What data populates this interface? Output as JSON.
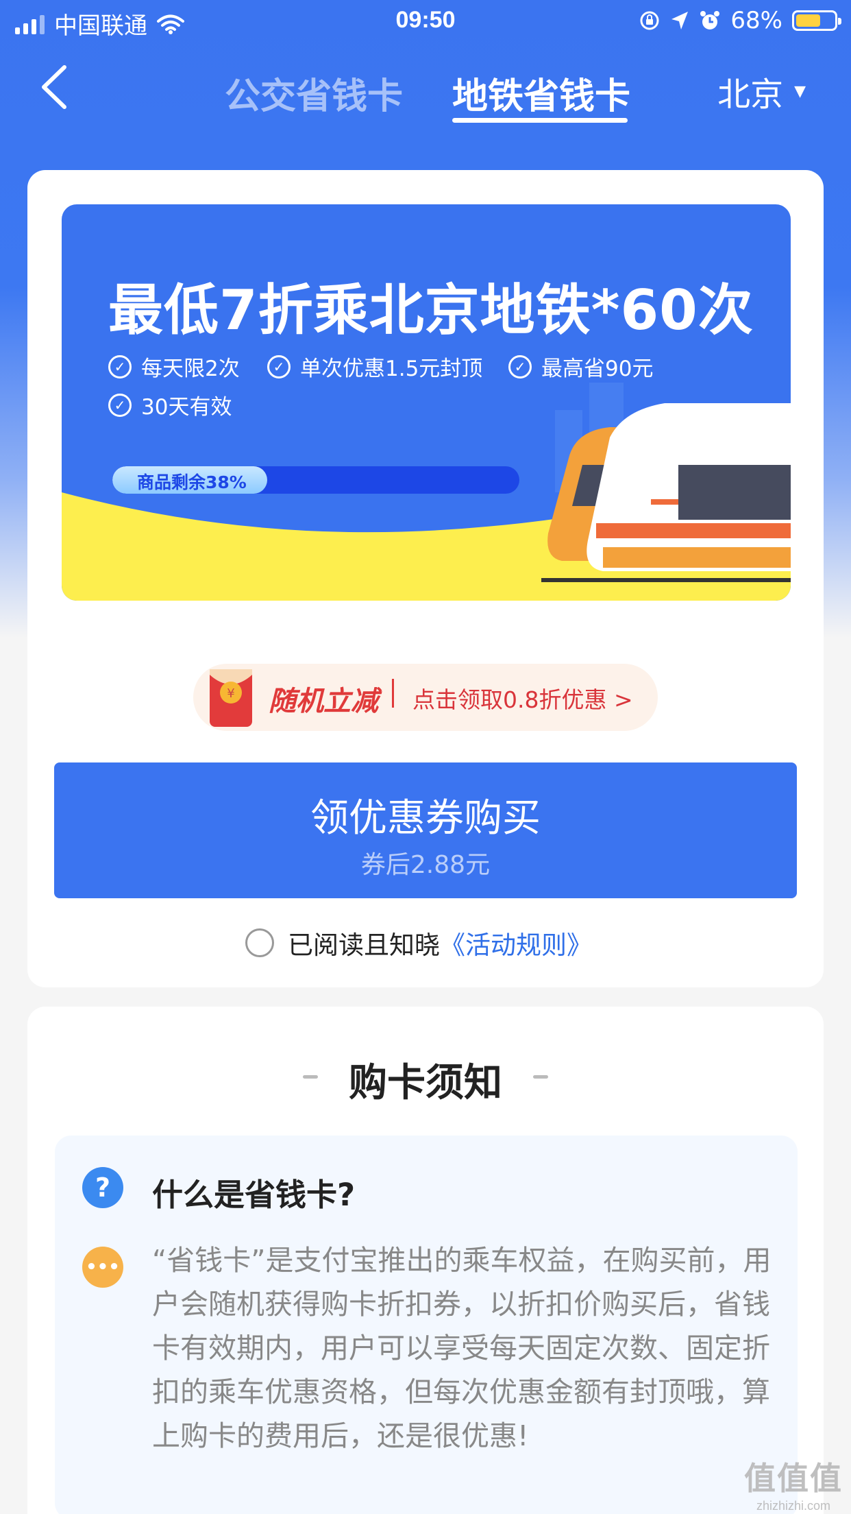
{
  "status_bar": {
    "carrier": "中国联通",
    "time": "09:50",
    "battery_percent": "68%",
    "battery_level": 0.68,
    "icons": [
      "signal-icon",
      "wifi-icon",
      "orientation-lock-icon",
      "location-icon",
      "alarm-icon",
      "battery-icon"
    ]
  },
  "nav": {
    "tabs": [
      {
        "label": "公交省钱卡",
        "active": false
      },
      {
        "label": "地铁省钱卡",
        "active": true
      }
    ],
    "city": "北京"
  },
  "banner": {
    "title": "最低7折乘北京地铁*60次",
    "features": [
      "每天限2次",
      "单次优惠1.5元封顶",
      "最高省90元",
      "30天有效"
    ],
    "stock_label": "商品剩余38%",
    "stock_remaining": 0.38
  },
  "promo": {
    "tag": "随机立减",
    "text": "点击领取0.8折优惠 >"
  },
  "buy_button": {
    "label": "领优惠券购买",
    "sub_label": "券后2.88元"
  },
  "agreement": {
    "text": "已阅读且知晓",
    "link": "《活动规则》"
  },
  "notice": {
    "title": "购卡须知",
    "question": "什么是省钱卡?",
    "answer": "“省钱卡”是支付宝推出的乘车权益，在购买前，用户会随机获得购卡折扣券，以折扣价购买后，省钱卡有效期内，用户可以享受每天固定次数、固定折扣的乘车优惠资格，但每次优惠金额有封顶哦，算上购卡的费用后，还是很优惠!"
  },
  "watermark": {
    "logo": "值值值",
    "url": "zhizhizhi.com"
  },
  "colors": {
    "primary_blue": "#3b74f0",
    "promo_red": "#e03a3a",
    "link_blue": "#2f6fe8",
    "banner_yellow": "#fdee4e"
  }
}
